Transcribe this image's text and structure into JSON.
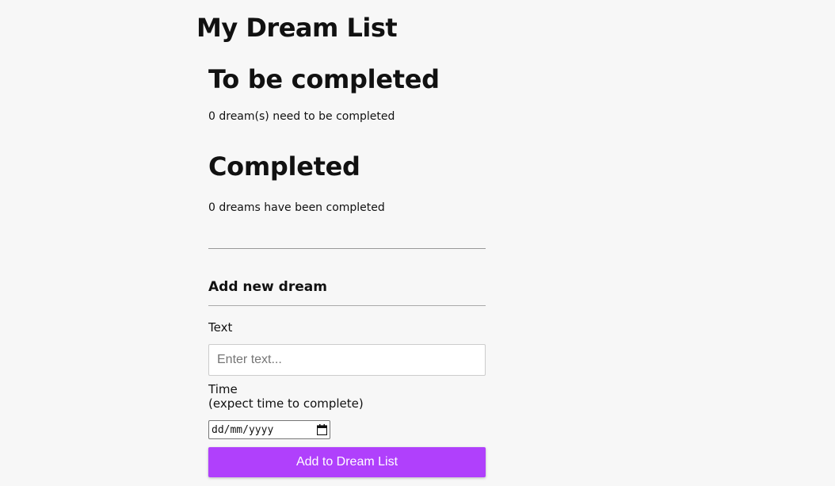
{
  "app": {
    "title": "My Dream List"
  },
  "todo": {
    "heading": "To be completed",
    "count_text": "0 dream(s) need to be completed"
  },
  "completed": {
    "heading": "Completed",
    "count_text": "0 dreams have been completed"
  },
  "form": {
    "title": "Add new dream",
    "text_label": "Text",
    "text_placeholder": "Enter text...",
    "text_value": "",
    "time_label_line1": "Time",
    "time_label_line2": "(expect time to complete)",
    "date_placeholder": "dd/mm/yyyy",
    "date_icon": "calendar-icon",
    "submit_label": "Add to Dream List"
  },
  "colors": {
    "background": "#f7f7f7",
    "accent": "#b040fc"
  }
}
